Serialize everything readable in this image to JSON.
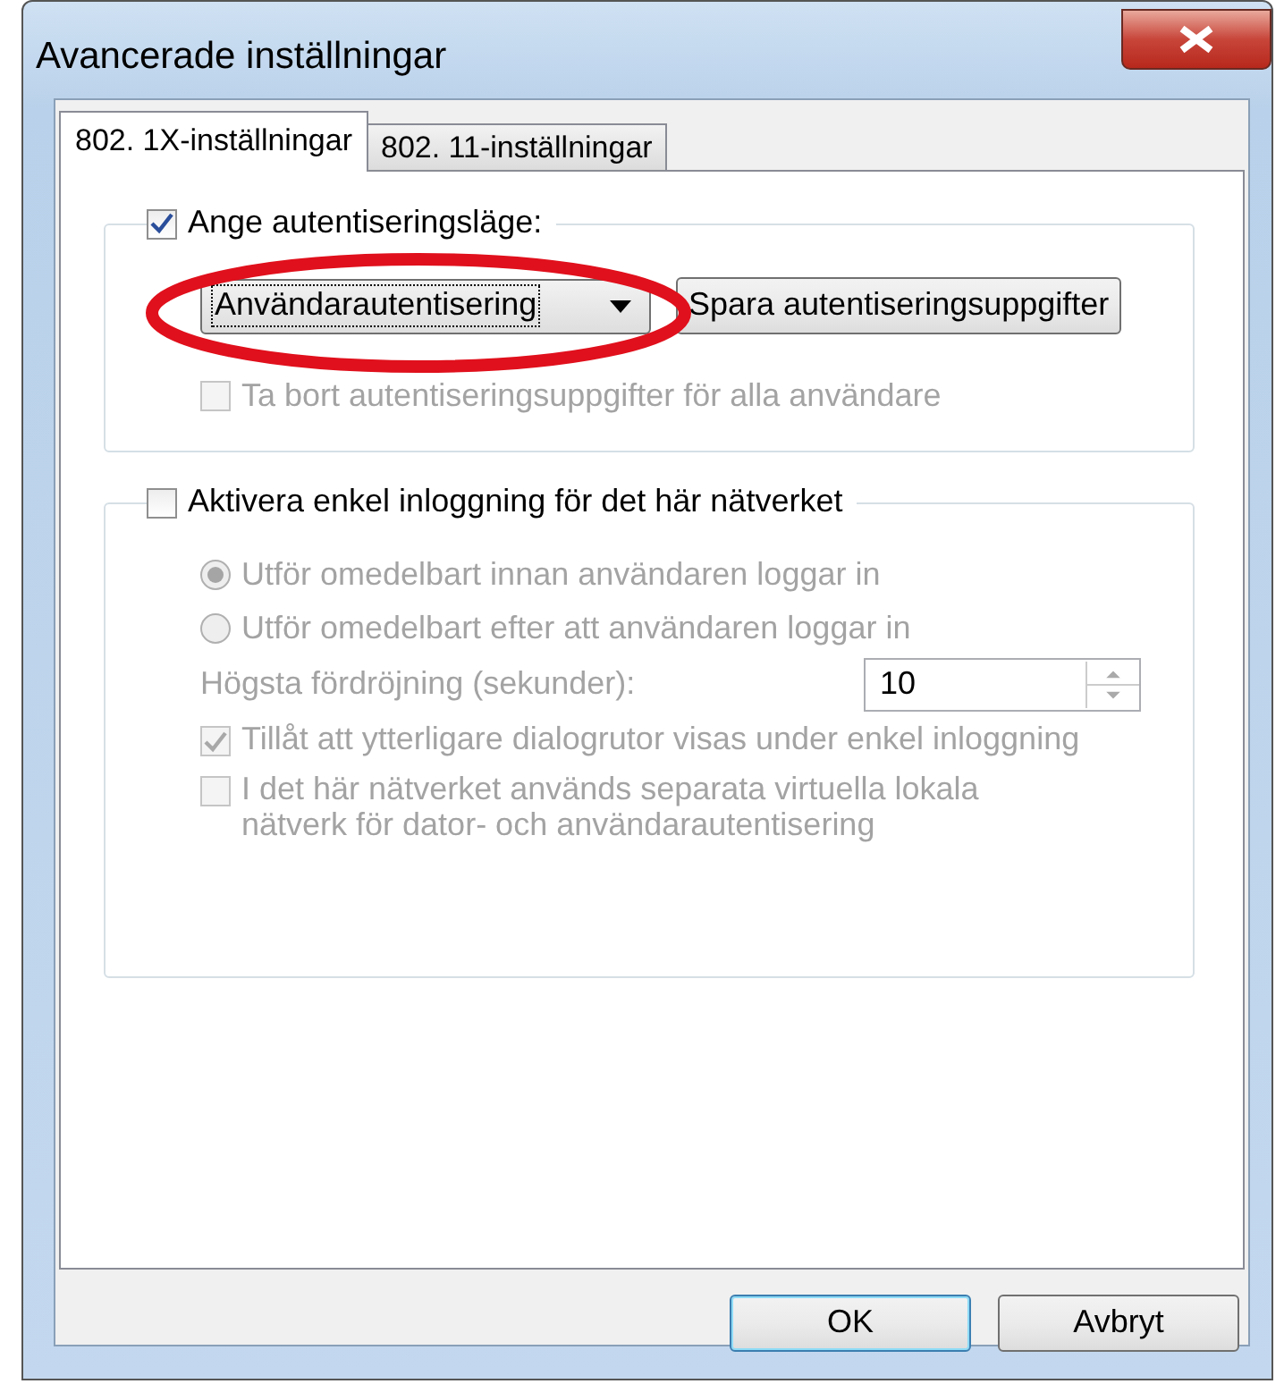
{
  "window": {
    "title": "Avancerade inställningar"
  },
  "tabs": [
    {
      "label": "802. 1X-inställningar",
      "selected": true
    },
    {
      "label": "802. 11-inställningar",
      "selected": false
    }
  ],
  "auth_group": {
    "label": "Ange autentiseringsläge:",
    "checked": true,
    "dropdown": {
      "value": "Användarautentisering"
    },
    "save_button": "Spara autentiseringsuppgifter",
    "remove_option": {
      "label": "Ta bort autentiseringsuppgifter för alla användare",
      "checked": false,
      "disabled": true
    }
  },
  "sso_group": {
    "label": "Aktivera enkel inloggning för det här nätverket",
    "checked": false,
    "items": [
      {
        "kind": "radio",
        "label": "Utför omedelbart innan användaren loggar in",
        "selected": true,
        "disabled": true
      },
      {
        "kind": "radio",
        "label": "Utför omedelbart efter att användaren loggar in",
        "selected": false,
        "disabled": true
      },
      {
        "kind": "number",
        "label": "Högsta fördröjning (sekunder):",
        "value": "10",
        "disabled": true
      },
      {
        "kind": "checkbox",
        "label": "Tillåt att ytterligare dialogrutor visas under enkel inloggning",
        "checked": true,
        "disabled": true
      },
      {
        "kind": "checkbox",
        "label": "I det här nätverket används separata virtuella lokala nätverk för dator- och användarautentisering",
        "checked": false,
        "disabled": true
      }
    ]
  },
  "buttons": [
    {
      "label": "OK",
      "default": true
    },
    {
      "label": "Avbryt",
      "default": false
    }
  ]
}
